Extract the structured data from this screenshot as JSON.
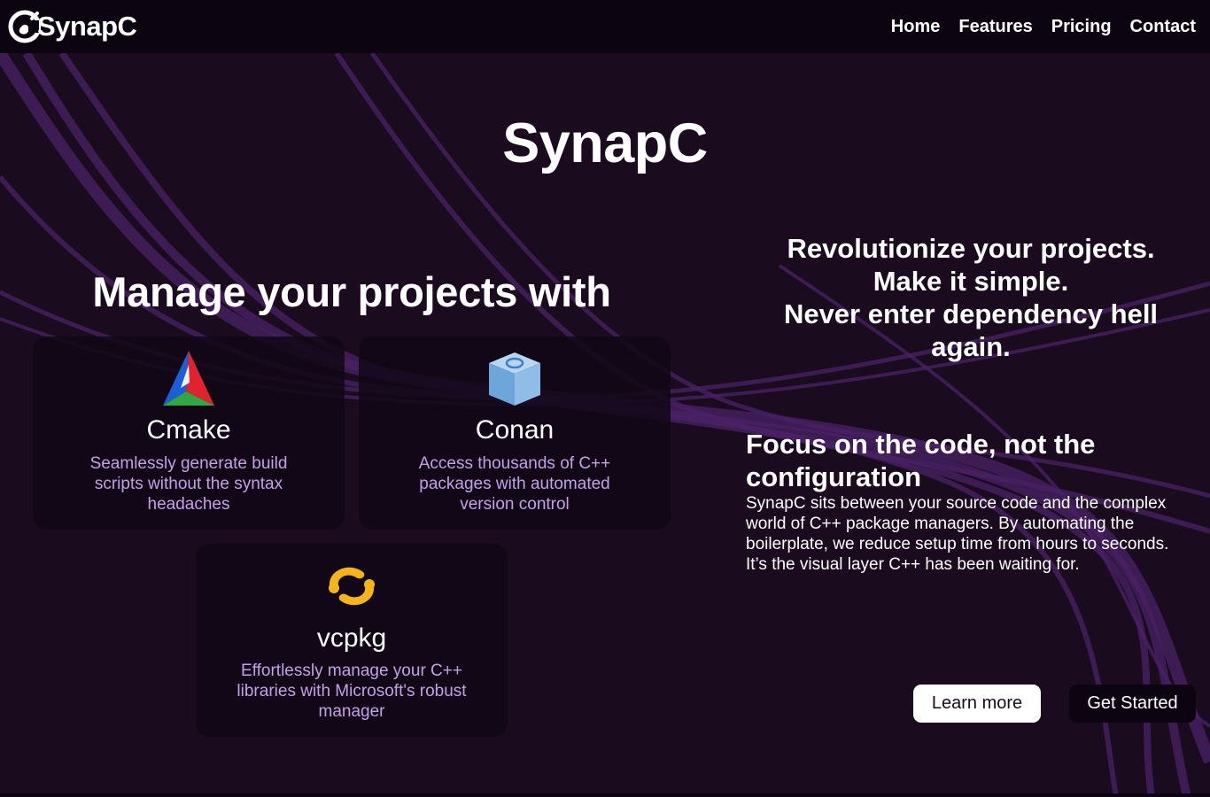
{
  "brand": {
    "name": "SynapC"
  },
  "nav": {
    "items": [
      {
        "label": "Home"
      },
      {
        "label": "Features"
      },
      {
        "label": "Pricing"
      },
      {
        "label": "Contact"
      }
    ]
  },
  "hero": {
    "title": "SynapC"
  },
  "manage": {
    "title": "Manage your projects with"
  },
  "cards": [
    {
      "icon": "cmake-logo-icon",
      "title": "Cmake",
      "description": "Seamlessly generate build scripts without the syntax headaches"
    },
    {
      "icon": "conan-logo-icon",
      "title": "Conan",
      "description": "Access thousands of C++ packages with automated version control"
    },
    {
      "icon": "vcpkg-logo-icon",
      "title": "vcpkg",
      "description": "Effortlessly manage your C++ libraries with Microsoft's robust manager"
    }
  ],
  "tagline": {
    "line1": "Revolutionize your projects.",
    "line2": "Make it simple.",
    "line3": "Never enter dependency hell again."
  },
  "focus": {
    "title": "Focus on the code, not the configuration",
    "body": "SynapC sits between your source code and the complex world of C++ package managers. By automating the boilerplate, we reduce setup time from hours to seconds. It’s the visual layer C++ has been waiting for."
  },
  "buttons": {
    "learn_more": "Learn more",
    "get_started": "Get Started"
  },
  "colors": {
    "background": "#1a0b1f",
    "navbar": "#0c0410",
    "card": "#110715",
    "card_text": "#c4a0e8",
    "wave": "#5a2a78"
  }
}
